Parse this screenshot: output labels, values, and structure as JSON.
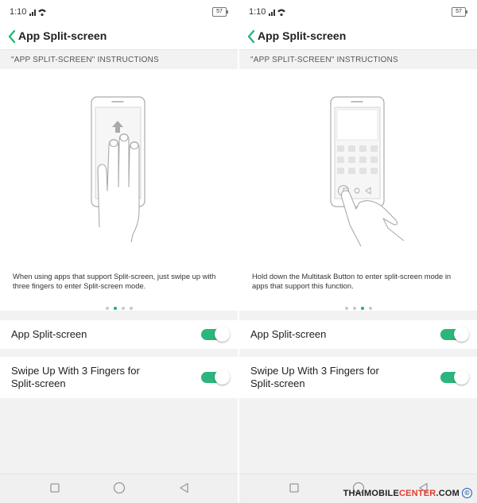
{
  "screens": [
    {
      "status": {
        "time": "1:10",
        "battery": "57"
      },
      "header": {
        "title": "App Split-screen"
      },
      "section_label": "\"APP SPLIT-SCREEN\" INSTRUCTIONS",
      "illustration": "three-finger-swipe",
      "description": "When using apps that support Split-screen, just swipe up with three fingers to enter Split-screen mode.",
      "pager": {
        "active_index": 1,
        "total": 4
      },
      "settings": [
        {
          "label": "App Split-screen",
          "enabled": true
        },
        {
          "label": "Swipe Up With 3 Fingers for Split-screen",
          "enabled": true
        }
      ]
    },
    {
      "status": {
        "time": "1:10",
        "battery": "57"
      },
      "header": {
        "title": "App Split-screen"
      },
      "section_label": "\"APP SPLIT-SCREEN\" INSTRUCTIONS",
      "illustration": "hold-multitask-button",
      "description": "Hold down the Multitask Button to enter split-screen mode in apps that support this function.",
      "pager": {
        "active_index": 2,
        "total": 4
      },
      "settings": [
        {
          "label": "App Split-screen",
          "enabled": true
        },
        {
          "label": "Swipe Up With 3 Fingers for Split-screen",
          "enabled": true
        }
      ]
    }
  ],
  "navbar": {
    "icons": [
      "recent-apps-icon",
      "home-icon",
      "back-triangle-icon"
    ]
  },
  "watermark": {
    "part1": "THAIMOBILE",
    "part2": "CENTER",
    "part3": ".COM",
    "symbol": "©"
  },
  "colors": {
    "accent": "#2cb57d",
    "dot_active": "#1db07a",
    "background": "#f2f2f2"
  }
}
